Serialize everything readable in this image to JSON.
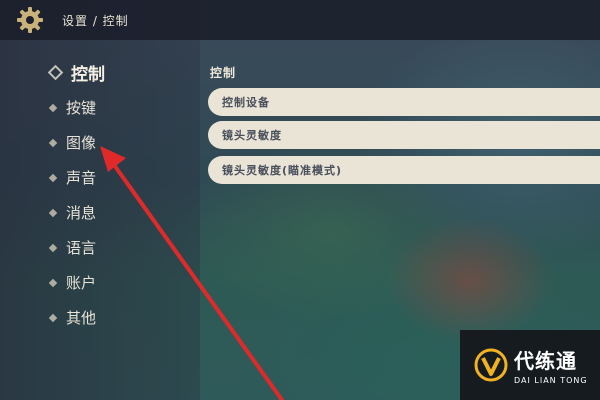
{
  "header": {
    "breadcrumb": "设置 / 控制",
    "icon": "gear-icon"
  },
  "sidebar": {
    "items": [
      {
        "label": "控制",
        "active": true
      },
      {
        "label": "按键",
        "active": false
      },
      {
        "label": "图像",
        "active": false
      },
      {
        "label": "声音",
        "active": false
      },
      {
        "label": "消息",
        "active": false
      },
      {
        "label": "语言",
        "active": false
      },
      {
        "label": "账户",
        "active": false
      },
      {
        "label": "其他",
        "active": false
      }
    ]
  },
  "main": {
    "section_title": "控制",
    "settings": [
      {
        "label": "控制设备"
      },
      {
        "label": "镜头灵敏度"
      },
      {
        "label": "镜头灵敏度(瞄准模式)"
      }
    ]
  },
  "watermark": {
    "name_cn": "代练通",
    "name_en": "DAI LIAN TONG"
  },
  "colors": {
    "accent": "#e9e4d6",
    "arrow": "#e02a2a",
    "topbar": "#1c202c"
  }
}
